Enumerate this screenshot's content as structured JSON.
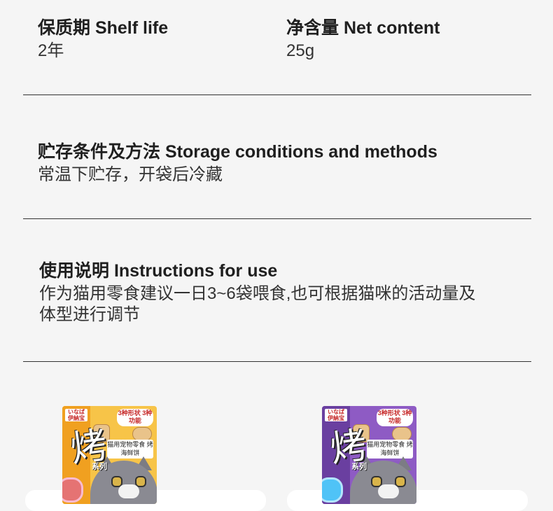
{
  "shelf_life": {
    "title": "保质期 Shelf life",
    "value": "2年"
  },
  "net_content": {
    "title": "净含量 Net content",
    "value": "25g"
  },
  "storage": {
    "title": "贮存条件及方法 Storage conditions and methods",
    "value": "常温下贮存，开袋后冷藏"
  },
  "instructions": {
    "title": "使用说明 Instructions for use",
    "line1": "作为猫用零食建议一日3~6袋喂食,也可根据猫咪的活动量及",
    "line2": "体型进行调节"
  },
  "products": [
    {
      "brand": "いなば 伊納宝",
      "badge": "3种形状 3种功能",
      "tag": "猫用宠物零食 烤海鲜饼",
      "series": "系列",
      "glyph": "烤",
      "band_color": "#f0a020",
      "body_color": "#f7c448"
    },
    {
      "brand": "いなば 伊納宝",
      "badge": "3种形状 3种功能",
      "tag": "猫用宠物零食 烤海鲜饼",
      "series": "系列",
      "glyph": "烤",
      "band_color": "#6a3fa0",
      "body_color": "#8e5bc4"
    }
  ]
}
